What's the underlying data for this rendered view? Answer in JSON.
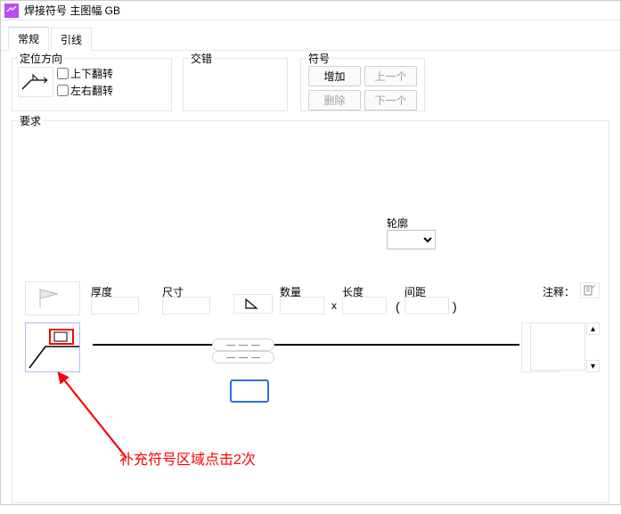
{
  "window_title": "焊接符号 主图幅 GB",
  "tabs": {
    "general": "常规",
    "leader": "引线"
  },
  "group_position": {
    "title": "定位方向",
    "flip_v": "上下翻转",
    "flip_h": "左右翻转"
  },
  "group_stagger": {
    "title": "交错"
  },
  "group_symbol": {
    "title": "符号",
    "add": "增加",
    "prev": "上一个",
    "delete": "删除",
    "next": "下一个"
  },
  "group_req": {
    "title": "要求"
  },
  "contour": {
    "label": "轮廓"
  },
  "fields": {
    "thickness": "厚度",
    "size": "尺寸",
    "quantity": "数量",
    "length": "长度",
    "pitch": "间距",
    "note": "注释："
  },
  "mult": "x",
  "paren_l": "(",
  "paren_r": ")",
  "annotation": "补充符号区域点击2次"
}
